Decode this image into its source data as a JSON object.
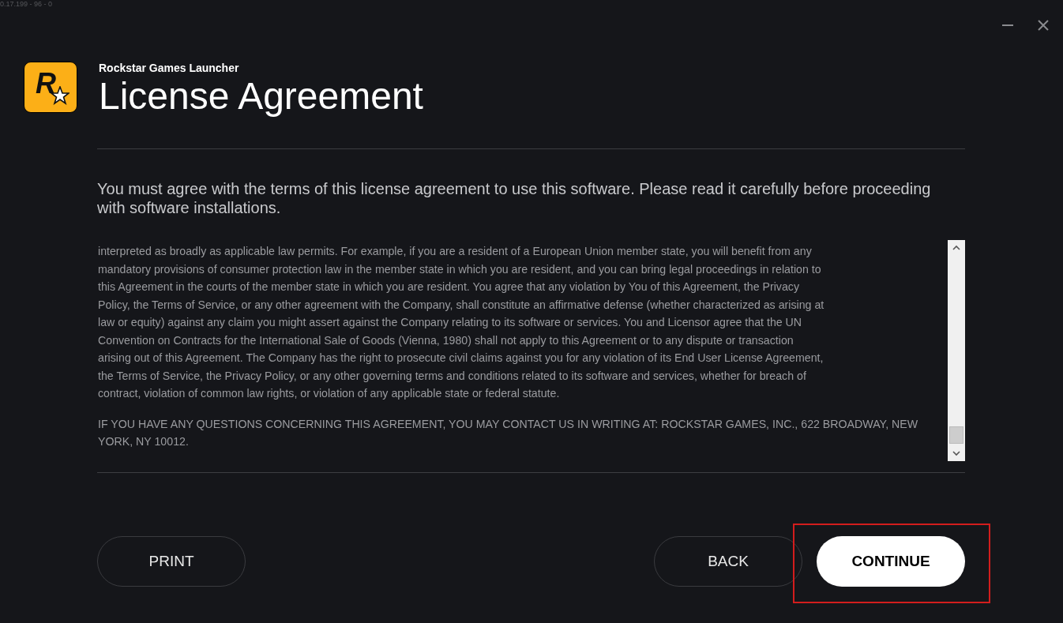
{
  "version": "0.17.199 - 96 - 0",
  "window_controls": [
    {
      "kind": "minimize"
    },
    {
      "kind": "close"
    }
  ],
  "header": {
    "logo_letter": "R",
    "app_name": "Rockstar Games Launcher",
    "title": "License Agreement"
  },
  "intro": "You must agree with the terms of this license agreement to use this software. Please read it carefully before proceeding with software installations.",
  "license_text": [
    {
      "lines": [
        "interpreted as broadly as applicable law permits. For example, if you are a resident of a European Union member state, you will benefit from any",
        "mandatory provisions of consumer protection law in the member state in which you are resident, and you can bring legal proceedings in relation to",
        "this Agreement in the courts of the member state in which you are resident.  You agree that any violation by You of this Agreement, the Privacy",
        "Policy, the Terms of Service, or any other agreement with the Company, shall constitute an affirmative defense (whether characterized as arising at",
        "law or equity) against any claim you might assert against the Company relating to its software or services. You and Licensor agree that the UN",
        "Convention on Contracts for the International Sale of Goods (Vienna, 1980) shall not apply to this Agreement or to any dispute or transaction",
        "arising out of this Agreement.  The Company has the right to prosecute civil claims against you for any violation of its End User License Agreement,",
        "the Terms of Service, the Privacy Policy, or any other governing terms and conditions related to its software and services, whether for breach of",
        "contract, violation of common law rights, or violation of any applicable state or federal statute."
      ]
    },
    {
      "lines": [
        "IF YOU HAVE ANY QUESTIONS CONCERNING THIS AGREEMENT, YOU MAY CONTACT US IN WRITING AT: ROCKSTAR GAMES, INC., 622 BROADWAY, NEW",
        "YORK, NY 10012."
      ]
    }
  ],
  "buttons": [
    {
      "label": "PRINT",
      "kind": "outline",
      "highlighted": false
    },
    {
      "label": "BACK",
      "kind": "outline",
      "highlighted": false
    },
    {
      "label": "CONTINUE",
      "kind": "primary",
      "highlighted": true
    }
  ]
}
